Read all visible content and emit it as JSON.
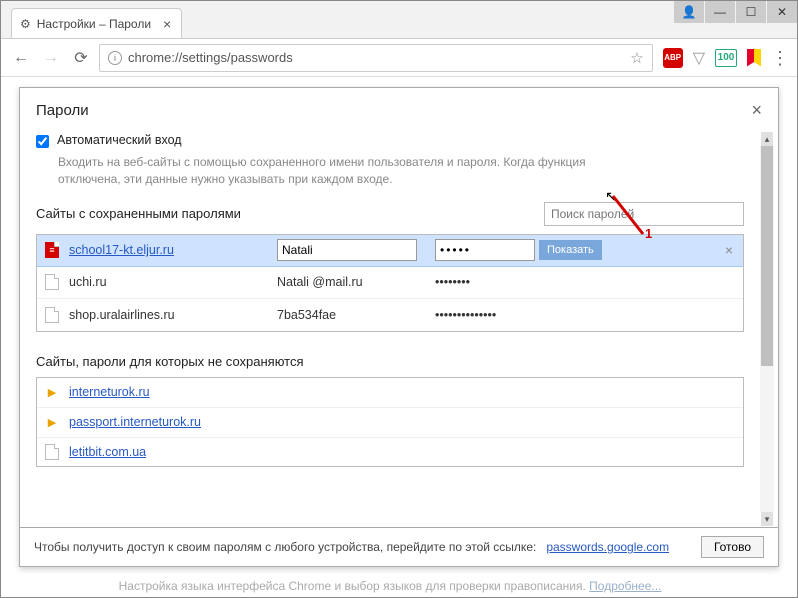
{
  "window": {
    "tab_title": "Настройки – Пароли"
  },
  "addressbar": {
    "url": "chrome://settings/passwords",
    "abp_label": "ABP",
    "translate_badge": "100"
  },
  "dialog": {
    "title": "Пароли",
    "auto_login_label": "Автоматический вход",
    "auto_login_desc": "Входить на веб-сайты с помощью сохраненного имени пользователя и пароля. Когда функция отключена, эти данные нужно указывать при каждом входе.",
    "saved_section_title": "Сайты с сохраненными паролями",
    "search_placeholder": "Поиск паролей",
    "show_button": "Показать",
    "saved": [
      {
        "site": "school17-kt.eljur.ru",
        "user": "Natali",
        "pass": "•••••",
        "selected": true,
        "icon": "red"
      },
      {
        "site": "uchi.ru",
        "user": "Natali @mail.ru",
        "pass": "••••••••",
        "selected": false,
        "icon": "file"
      },
      {
        "site": "shop.uralairlines.ru",
        "user": "7ba534fae",
        "pass": "••••••••••••••",
        "selected": false,
        "icon": "file"
      }
    ],
    "never_section_title": "Сайты, пароли для которых не сохраняются",
    "never": [
      {
        "site": "interneturok.ru"
      },
      {
        "site": "passport.interneturok.ru"
      },
      {
        "site": "letitbit.com.ua"
      }
    ],
    "footer_text": "Чтобы получить доступ к своим паролям с любого устройства, перейдите по этой ссылке:",
    "footer_link": "passwords.google.com",
    "done_button": "Готово"
  },
  "page_hint": {
    "text": "Настройка языка интерфейса Chrome и выбор языков для проверки правописания.",
    "link": "Подробнее..."
  },
  "annotation": {
    "label": "1"
  }
}
